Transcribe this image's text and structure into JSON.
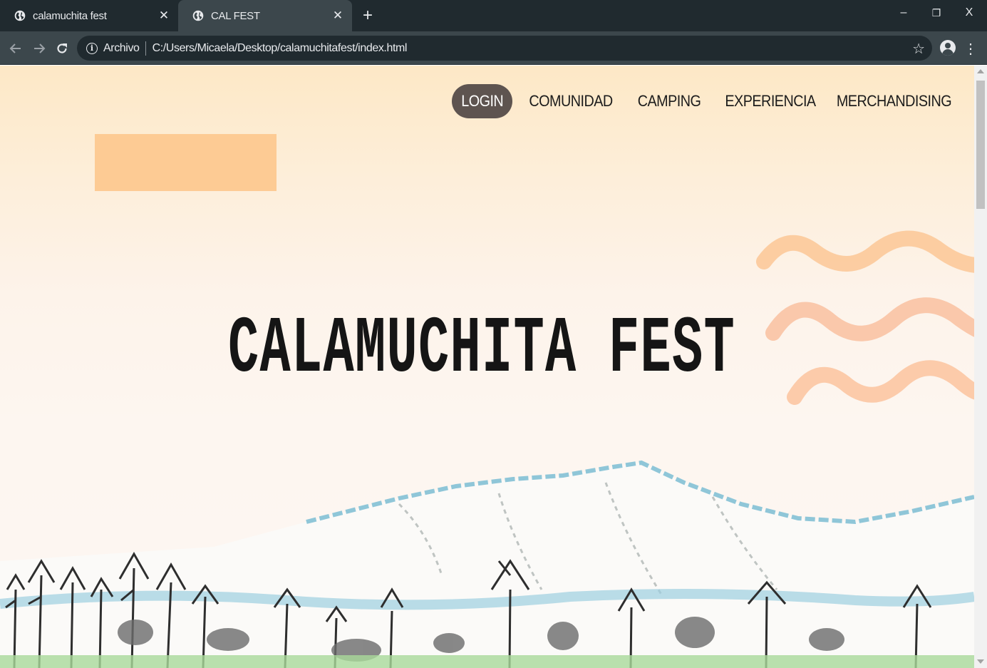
{
  "browser": {
    "tabs": [
      {
        "title": "calamuchita fest",
        "active": false
      },
      {
        "title": "CAL FEST",
        "active": true
      }
    ],
    "new_tab_label": "+",
    "window_controls": {
      "minimize": "–",
      "restore": "❐",
      "close": "X"
    },
    "address_bar": {
      "scheme_label": "Archivo",
      "url": "C:/Users/Micaela/Desktop/calamuchitafest/index.html"
    }
  },
  "page": {
    "nav": [
      {
        "label": "LOGIN",
        "highlighted": true
      },
      {
        "label": "COMUNIDAD"
      },
      {
        "label": "CAMPING"
      },
      {
        "label": "EXPERIENCIA"
      },
      {
        "label": "MERCHANDISING"
      }
    ],
    "headline": "CALAMUCHITA FEST",
    "colors": {
      "login_bg": "#5e5450",
      "orange_block": "#fdcb94",
      "wave": "#fbbf8f",
      "chrome_dark": "#202a2f",
      "chrome_toolbar": "#3c474c"
    }
  }
}
